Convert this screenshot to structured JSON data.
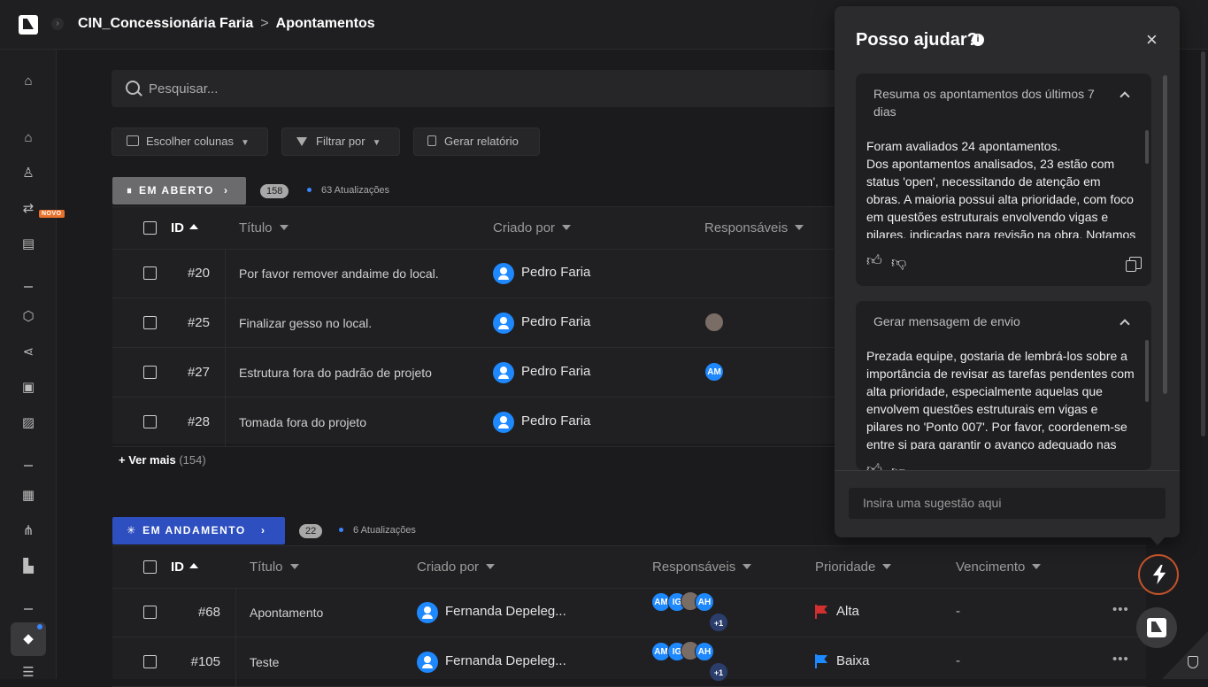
{
  "breadcrumb": {
    "project": "CIN_Concessionária Faria",
    "page": "Apontamentos"
  },
  "sidebar": {
    "new_badge": "NOVO"
  },
  "search": {
    "placeholder": "Pesquisar..."
  },
  "toolbar": {
    "columns": "Escolher colunas",
    "filter": "Filtrar por",
    "report": "Gerar relatório"
  },
  "open_group": {
    "label": "EM ABERTO",
    "count": "158",
    "updates": "63 Atualizações",
    "headers": {
      "id": "ID",
      "title": "Título",
      "created_by": "Criado por",
      "assignees": "Responsáveis"
    },
    "rows": [
      {
        "id": "#20",
        "title": "Por favor remover andaime do local.",
        "created_by": "Pedro Faria",
        "assignees": []
      },
      {
        "id": "#25",
        "title": "Finalizar gesso no local.",
        "created_by": "Pedro Faria",
        "assignees": [
          "photo"
        ]
      },
      {
        "id": "#27",
        "title": "Estrutura fora do padrão de projeto",
        "created_by": "Pedro Faria",
        "assignees": [
          "AM"
        ]
      },
      {
        "id": "#28",
        "title": "Tomada fora do projeto",
        "created_by": "Pedro Faria",
        "assignees": []
      }
    ],
    "see_more": "+ Ver mais",
    "see_more_count": "(154)"
  },
  "progress_group": {
    "label": "EM ANDAMENTO",
    "count": "22",
    "updates": "6 Atualizações",
    "headers": {
      "id": "ID",
      "title": "Título",
      "created_by": "Criado por",
      "assignees": "Responsáveis",
      "priority": "Prioridade",
      "due": "Vencimento"
    },
    "rows": [
      {
        "id": "#68",
        "title": "Apontamento",
        "created_by": "Fernanda Depeleg...",
        "assignee_initials": [
          "AM",
          "IG",
          "AH"
        ],
        "more": "+1",
        "priority": "Alta",
        "priority_color": "#d32f2f",
        "due": "-"
      },
      {
        "id": "#105",
        "title": "Teste",
        "created_by": "Fernanda Depeleg...",
        "assignee_initials": [
          "AM",
          "IG",
          "AH"
        ],
        "more": "+1",
        "priority": "Baixa",
        "priority_color": "#1e88ff",
        "due": "-"
      }
    ]
  },
  "assistant": {
    "title": "Posso ajudar?",
    "cards": [
      {
        "question": "Resuma os apontamentos dos últimos 7 dias",
        "answer": "Foram avaliados 24 apontamentos.\nDos apontamentos analisados, 23 estão com status 'open', necessitando de atenção em obras. A maioria possui alta prioridade, com foco em questões estruturais envolvendo vigas e pilares, indicadas para revisão na obra. Notamos que"
      },
      {
        "question": "Gerar mensagem de envio",
        "answer": "Prezada equipe, gostaria de lembrá-los sobre a importância de revisar as tarefas pendentes com alta prioridade, especialmente aquelas que envolvem questões estruturais em vigas e pilares no 'Ponto 007'. Por favor, coordenem-se entre si para garantir o avanço adequado nas verificações"
      }
    ],
    "input_placeholder": "Insira uma sugestão aqui"
  }
}
